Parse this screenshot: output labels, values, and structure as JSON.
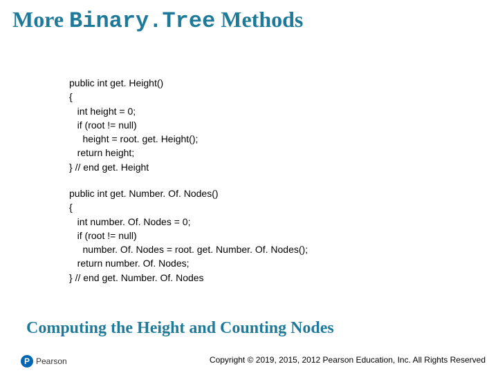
{
  "title": {
    "pre": "More ",
    "mono": "Binary.Tree",
    "post": " Methods"
  },
  "code1": {
    "l0": "public int get. Height()",
    "l1": "{",
    "l2": "   int height = 0;",
    "l3": "   if (root != null)",
    "l4": "     height = root. get. Height();",
    "l5": "   return height;",
    "l6": "} // end get. Height"
  },
  "code2": {
    "l0": "public int get. Number. Of. Nodes()",
    "l1": "{",
    "l2": "   int number. Of. Nodes = 0;",
    "l3": "   if (root != null)",
    "l4": "     number. Of. Nodes = root. get. Number. Of. Nodes();",
    "l5": "   return number. Of. Nodes;",
    "l6": "} // end get. Number. Of. Nodes"
  },
  "subtitle": "Computing the Height and Counting Nodes",
  "logo": {
    "p": "P",
    "text": "Pearson"
  },
  "footer": "Copyright © 2019, 2015, 2012 Pearson Education, Inc. All Rights Reserved"
}
